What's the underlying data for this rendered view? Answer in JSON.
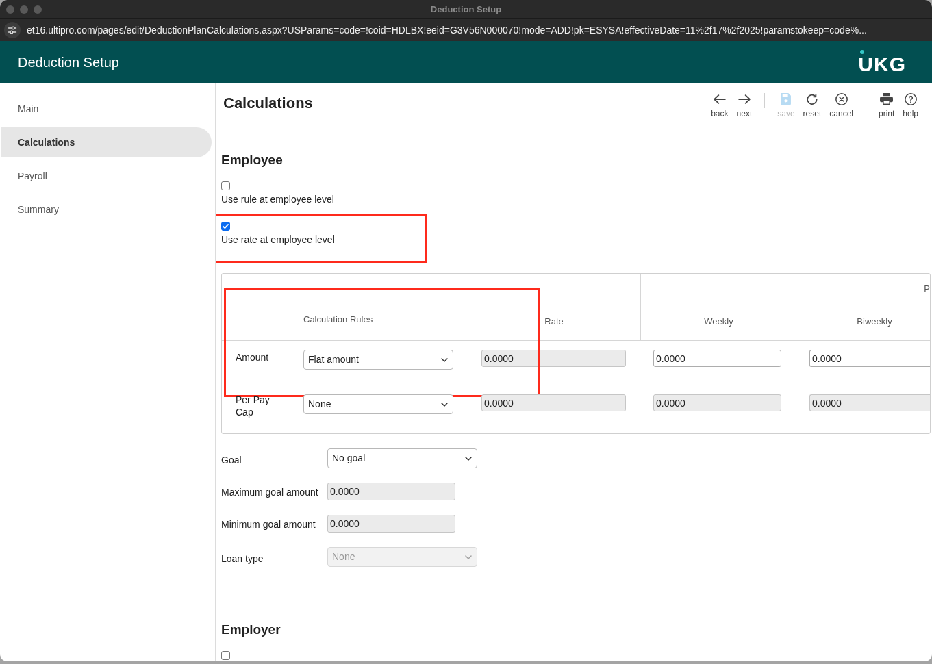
{
  "window": {
    "title": "Deduction Setup",
    "address": "et16.ultipro.com/pages/edit/DeductionPlanCalculations.aspx?USParams=code=!coid=HDLBX!eeid=G3V56N000070!mode=ADD!pk=ESYSA!effectiveDate=11%2f17%2f2025!paramstokeep=code%..."
  },
  "header": {
    "title": "Deduction Setup",
    "logo": "UKG"
  },
  "sidebar": {
    "items": [
      {
        "label": "Main",
        "selected": false
      },
      {
        "label": "Calculations",
        "selected": true
      },
      {
        "label": "Payroll",
        "selected": false
      },
      {
        "label": "Summary",
        "selected": false
      }
    ]
  },
  "page": {
    "title": "Calculations",
    "toolbar": [
      {
        "items": [
          {
            "kind": "back",
            "label": "back",
            "disabled": false
          },
          {
            "kind": "next",
            "label": "next",
            "disabled": false
          }
        ]
      },
      {
        "items": [
          {
            "kind": "save",
            "label": "save",
            "disabled": true
          },
          {
            "kind": "reset",
            "label": "reset",
            "disabled": false
          },
          {
            "kind": "cancel",
            "label": "cancel",
            "disabled": false
          }
        ]
      },
      {
        "items": [
          {
            "kind": "print",
            "label": "print",
            "disabled": false
          },
          {
            "kind": "help",
            "label": "help",
            "disabled": false
          }
        ]
      }
    ]
  },
  "employee": {
    "heading": "Employee",
    "options": [
      {
        "label": "Use rule at employee level",
        "checked": false,
        "highlighted": false
      },
      {
        "label": "Use rate at employee level",
        "checked": true,
        "highlighted": true
      }
    ],
    "calculation_table": {
      "column_group": "P",
      "columns": [
        "Calculation Rules",
        "Rate",
        "Weekly",
        "Biweekly"
      ],
      "rows": [
        {
          "label": "Amount",
          "rule": "Flat amount",
          "highlighted": true,
          "cells": [
            {
              "value": "0.0000",
              "disabled": true
            },
            {
              "value": "0.0000",
              "disabled": false
            },
            {
              "value": "0.0000",
              "disabled": false
            }
          ]
        },
        {
          "label": "Per Pay Cap",
          "rule": "None",
          "highlighted": false,
          "cells": [
            {
              "value": "0.0000",
              "disabled": true
            },
            {
              "value": "0.0000",
              "disabled": true
            },
            {
              "value": "0.0000",
              "disabled": true
            }
          ]
        }
      ]
    },
    "goal_fields": [
      {
        "label": "Goal",
        "kind": "select",
        "value": "No goal",
        "disabled": false
      },
      {
        "label": "Maximum goal amount",
        "kind": "input",
        "value": "0.0000",
        "disabled": true
      },
      {
        "label": "Minimum goal amount",
        "kind": "input",
        "value": "0.0000",
        "disabled": true
      },
      {
        "label": "Loan type",
        "kind": "select",
        "value": "None",
        "disabled": true
      }
    ]
  },
  "employer": {
    "heading": "Employer",
    "options": [
      {
        "checked": false
      }
    ]
  }
}
